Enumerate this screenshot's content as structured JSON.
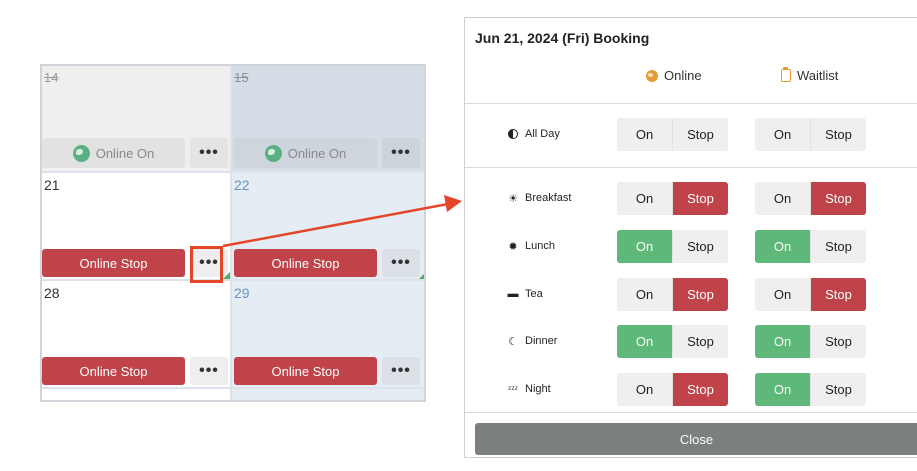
{
  "calendar": {
    "days": {
      "d14": "14",
      "d15": "15",
      "d21": "21",
      "d22": "22",
      "d28": "28",
      "d29": "29"
    },
    "online_on_label": "Online On",
    "online_stop_label": "Online Stop",
    "more_label": "•••"
  },
  "modal": {
    "title": "Jun 21, 2024 (Fri) Booking",
    "columns": {
      "online": "Online",
      "waitlist": "Waitlist"
    },
    "option_on": "On",
    "option_stop": "Stop",
    "rows": [
      {
        "label": "All Day",
        "icon": "half-circle-icon",
        "online": "none",
        "waitlist": "none"
      },
      {
        "label": "Breakfast",
        "icon": "sunrise-icon",
        "online": "stop",
        "waitlist": "stop"
      },
      {
        "label": "Lunch",
        "icon": "sun-icon",
        "online": "on",
        "waitlist": "on"
      },
      {
        "label": "Tea",
        "icon": "cup-icon",
        "online": "stop",
        "waitlist": "stop"
      },
      {
        "label": "Dinner",
        "icon": "moon-icon",
        "online": "on",
        "waitlist": "on"
      },
      {
        "label": "Night",
        "icon": "sleep-icon",
        "online": "stop",
        "waitlist": "on"
      }
    ],
    "close_label": "Close"
  },
  "colors": {
    "on_active": "#5db879",
    "stop_active": "#c0434a",
    "accent_orange": "#e59a33",
    "highlight": "#e5462a"
  }
}
